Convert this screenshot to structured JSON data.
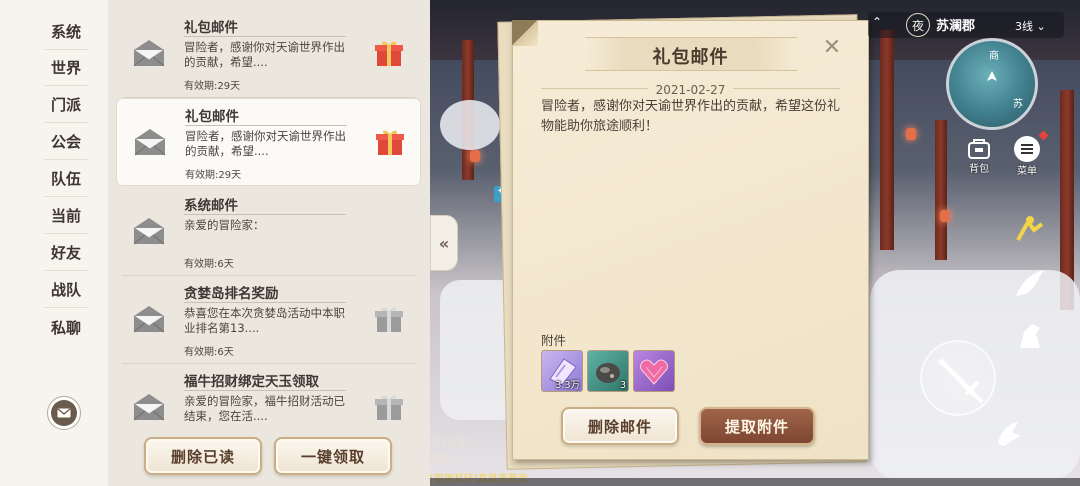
{
  "sidebar": {
    "categories": [
      "系统",
      "世界",
      "门派",
      "公会",
      "队伍",
      "当前",
      "好友",
      "战队",
      "私聊"
    ]
  },
  "mail_list": {
    "items": [
      {
        "title": "礼包邮件",
        "preview": "冒险者，感谢你对天谕世界作出的贡献，希望....",
        "expire": "有效期:29天",
        "gift": "red"
      },
      {
        "title": "礼包邮件",
        "preview": "冒险者，感谢你对天谕世界作出的贡献，希望....",
        "expire": "有效期:29天",
        "gift": "red"
      },
      {
        "title": "系统邮件",
        "preview": "亲爱的冒险家：",
        "expire": "有效期:6天",
        "gift": "none"
      },
      {
        "title": "贪婪岛排名奖励",
        "preview": "恭喜您在本次贪婪岛活动中本职业排名第13....",
        "expire": "有效期:6天",
        "gift": "grey"
      },
      {
        "title": "福牛招财绑定天玉领取",
        "preview": "亲爱的冒险家，福牛招财活动已结束，您在活....",
        "expire": "",
        "gift": "grey"
      }
    ],
    "delete_read_label": "删除已读",
    "claim_all_label": "一键领取"
  },
  "detail": {
    "title": "礼包邮件",
    "date": "2021-02-27",
    "body": "冒险者，感谢你对天谕世界作出的贡献，希望这份礼物能助你旅途顺利！",
    "attachments_label": "附件",
    "attachments": [
      {
        "icon": "purple-card-icon",
        "count": "3.3万"
      },
      {
        "icon": "ore-stone-icon",
        "count": "3"
      },
      {
        "icon": "pink-heart-gem-icon",
        "count": ""
      }
    ],
    "delete_label": "删除邮件",
    "extract_label": "提取附件"
  },
  "hud": {
    "night": "夜",
    "area": "苏澜郡",
    "line": "3线",
    "minimap_label": "苏",
    "minimap_label2": "商",
    "bag_label": "背包",
    "menu_label": "菜单"
  },
  "chat": {
    "line1": "青1-4速",
    "line2": "镇妖",
    "line3": "[狙歌耳环]真是羡慕旁人!"
  },
  "colors": {
    "accent_brown": "#7d4631",
    "gift_red": "#e0483c",
    "paper": "#f3e8d0"
  }
}
